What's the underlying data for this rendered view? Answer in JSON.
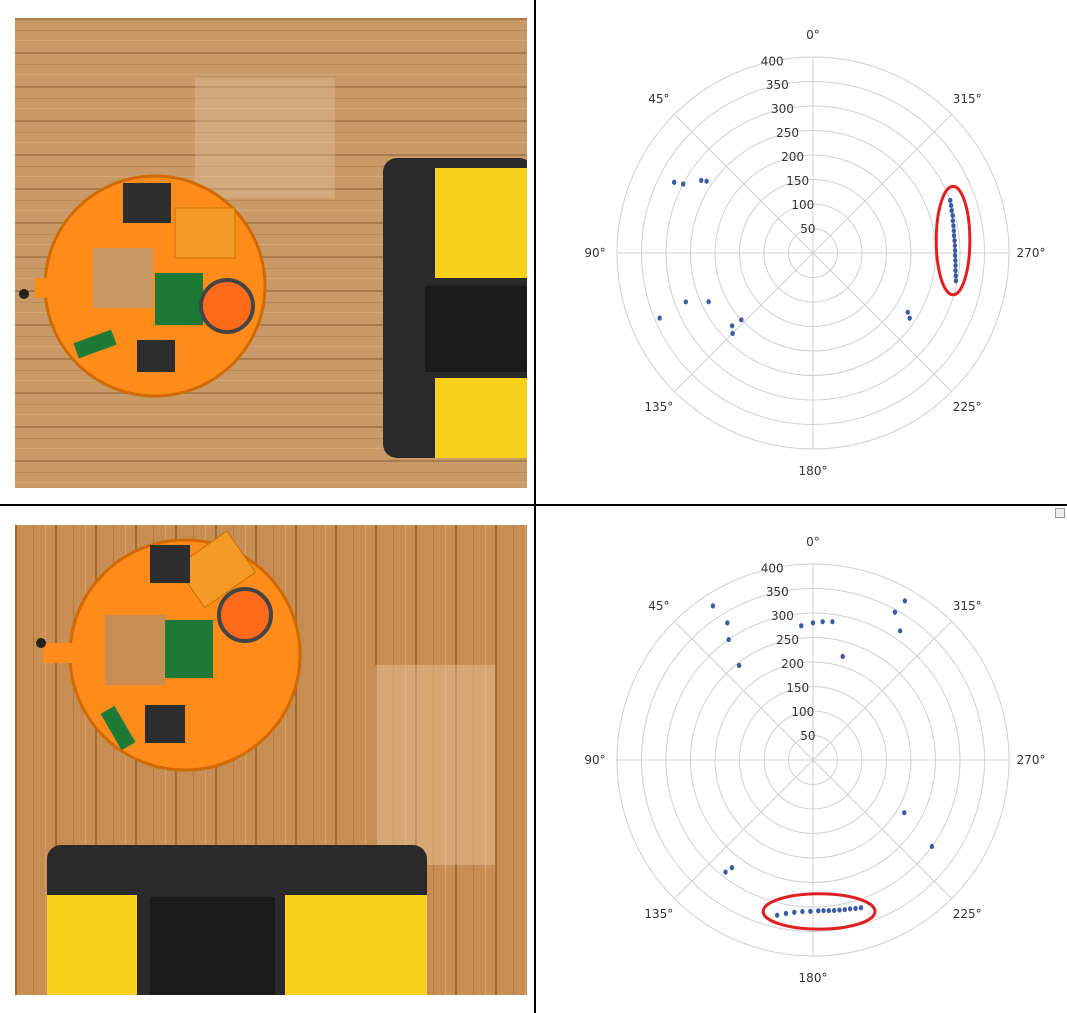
{
  "panels": [
    {
      "photo": "robot-top-view-toolbox-right",
      "chart_data": {
        "type": "scatter",
        "projection": "polar",
        "theta_zero_location": "top",
        "theta_direction": "counter-clockwise",
        "rlim": [
          0,
          400
        ],
        "radial_ticks": [
          "50",
          "100",
          "150",
          "200",
          "250",
          "300",
          "350",
          "400"
        ],
        "angle_ticks": [
          "0°",
          "45°",
          "90°",
          "135°",
          "180°",
          "225°",
          "270°",
          "315°"
        ],
        "grid": true,
        "points": [
          {
            "theta": 291,
            "r": 300
          },
          {
            "theta": 289,
            "r": 298
          },
          {
            "theta": 287,
            "r": 296
          },
          {
            "theta": 285,
            "r": 295
          },
          {
            "theta": 283,
            "r": 293
          },
          {
            "theta": 281,
            "r": 292
          },
          {
            "theta": 279,
            "r": 291
          },
          {
            "theta": 277,
            "r": 290
          },
          {
            "theta": 275,
            "r": 290
          },
          {
            "theta": 273,
            "r": 290
          },
          {
            "theta": 271,
            "r": 290
          },
          {
            "theta": 269,
            "r": 290
          },
          {
            "theta": 267,
            "r": 291
          },
          {
            "theta": 265,
            "r": 292
          },
          {
            "theta": 263,
            "r": 293
          },
          {
            "theta": 261,
            "r": 295
          },
          {
            "theta": 259,
            "r": 297
          },
          {
            "theta": 238,
            "r": 228
          },
          {
            "theta": 236,
            "r": 238
          },
          {
            "theta": 63,
            "r": 318
          },
          {
            "theta": 62,
            "r": 300
          },
          {
            "theta": 57,
            "r": 272
          },
          {
            "theta": 56,
            "r": 262
          },
          {
            "theta": 113,
            "r": 340
          },
          {
            "theta": 111,
            "r": 278
          },
          {
            "theta": 115,
            "r": 235
          },
          {
            "theta": 133,
            "r": 200
          },
          {
            "theta": 135,
            "r": 232
          },
          {
            "theta": 132,
            "r": 222
          }
        ],
        "highlight": {
          "shape": "ellipse",
          "color": "#e02020"
        }
      }
    },
    {
      "photo": "robot-top-view-toolbox-below",
      "chart_data": {
        "type": "scatter",
        "projection": "polar",
        "theta_zero_location": "top",
        "theta_direction": "counter-clockwise",
        "rlim": [
          0,
          400
        ],
        "radial_ticks": [
          "50",
          "100",
          "150",
          "200",
          "250",
          "300",
          "350",
          "400"
        ],
        "angle_ticks": [
          "0°",
          "45°",
          "90°",
          "135°",
          "180°",
          "225°",
          "270°",
          "315°"
        ],
        "grid": true,
        "points": [
          {
            "theta": 167,
            "r": 325
          },
          {
            "theta": 170,
            "r": 318
          },
          {
            "theta": 173,
            "r": 313
          },
          {
            "theta": 176,
            "r": 310
          },
          {
            "theta": 179,
            "r": 309
          },
          {
            "theta": 182,
            "r": 308
          },
          {
            "theta": 184,
            "r": 308
          },
          {
            "theta": 186,
            "r": 309
          },
          {
            "theta": 188,
            "r": 310
          },
          {
            "theta": 190,
            "r": 311
          },
          {
            "theta": 192,
            "r": 312
          },
          {
            "theta": 194,
            "r": 313
          },
          {
            "theta": 196,
            "r": 315
          },
          {
            "theta": 198,
            "r": 317
          },
          {
            "theta": 142,
            "r": 290
          },
          {
            "theta": 143,
            "r": 275
          },
          {
            "theta": 240,
            "r": 215
          },
          {
            "theta": 234,
            "r": 300
          },
          {
            "theta": 33,
            "r": 375
          },
          {
            "theta": 32,
            "r": 330
          },
          {
            "theta": 35,
            "r": 300
          },
          {
            "theta": 38,
            "r": 245
          },
          {
            "theta": 5,
            "r": 275
          },
          {
            "theta": 0,
            "r": 280
          },
          {
            "theta": 356,
            "r": 283
          },
          {
            "theta": 352,
            "r": 285
          },
          {
            "theta": 344,
            "r": 220
          },
          {
            "theta": 330,
            "r": 375
          },
          {
            "theta": 331,
            "r": 345
          },
          {
            "theta": 326,
            "r": 318
          }
        ],
        "highlight": {
          "shape": "ellipse",
          "color": "#e02020"
        }
      }
    }
  ]
}
